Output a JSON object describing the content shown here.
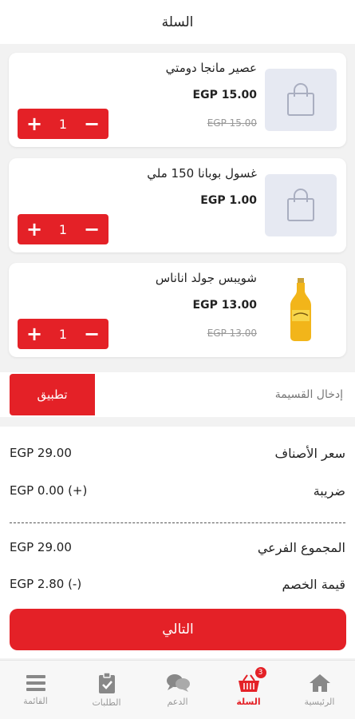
{
  "header": {
    "title": "السلة"
  },
  "cart_items": [
    {
      "name": "عصير مانجا دومتي",
      "price": "EGP 15.00",
      "old_price": "EGP 15.00",
      "quantity": "1",
      "image": "bag-placeholder-icon"
    },
    {
      "name": "غسول بوبانا 150 ملي",
      "price": "EGP 1.00",
      "old_price": "",
      "quantity": "1",
      "image": "bag-placeholder-icon"
    },
    {
      "name": "شويبس جولد اناناس",
      "price": "EGP 13.00",
      "old_price": "EGP 13.00",
      "quantity": "1",
      "image": "bottle-photo"
    }
  ],
  "coupon": {
    "placeholder": "إدخال القسيمة",
    "apply_label": "تطبيق"
  },
  "summary": {
    "items_price_label": "سعر الأصناف",
    "items_price_value": "EGP 29.00",
    "tax_label": "ضريبة",
    "tax_value": "EGP 0.00 (+)",
    "subtotal_label": "المجموع الفرعي",
    "subtotal_value": "EGP 29.00",
    "discount_label": "قيمة الخصم",
    "discount_value": "EGP 2.80 (-)"
  },
  "next_label": "التالي",
  "nav": {
    "home": "الرئيسية",
    "cart": "السلة",
    "cart_badge": "3",
    "support": "الدعم",
    "orders": "الطلبات",
    "menu": "القائمة"
  },
  "colors": {
    "accent": "#e42127",
    "placeholder_bg": "#e6e9f2"
  }
}
